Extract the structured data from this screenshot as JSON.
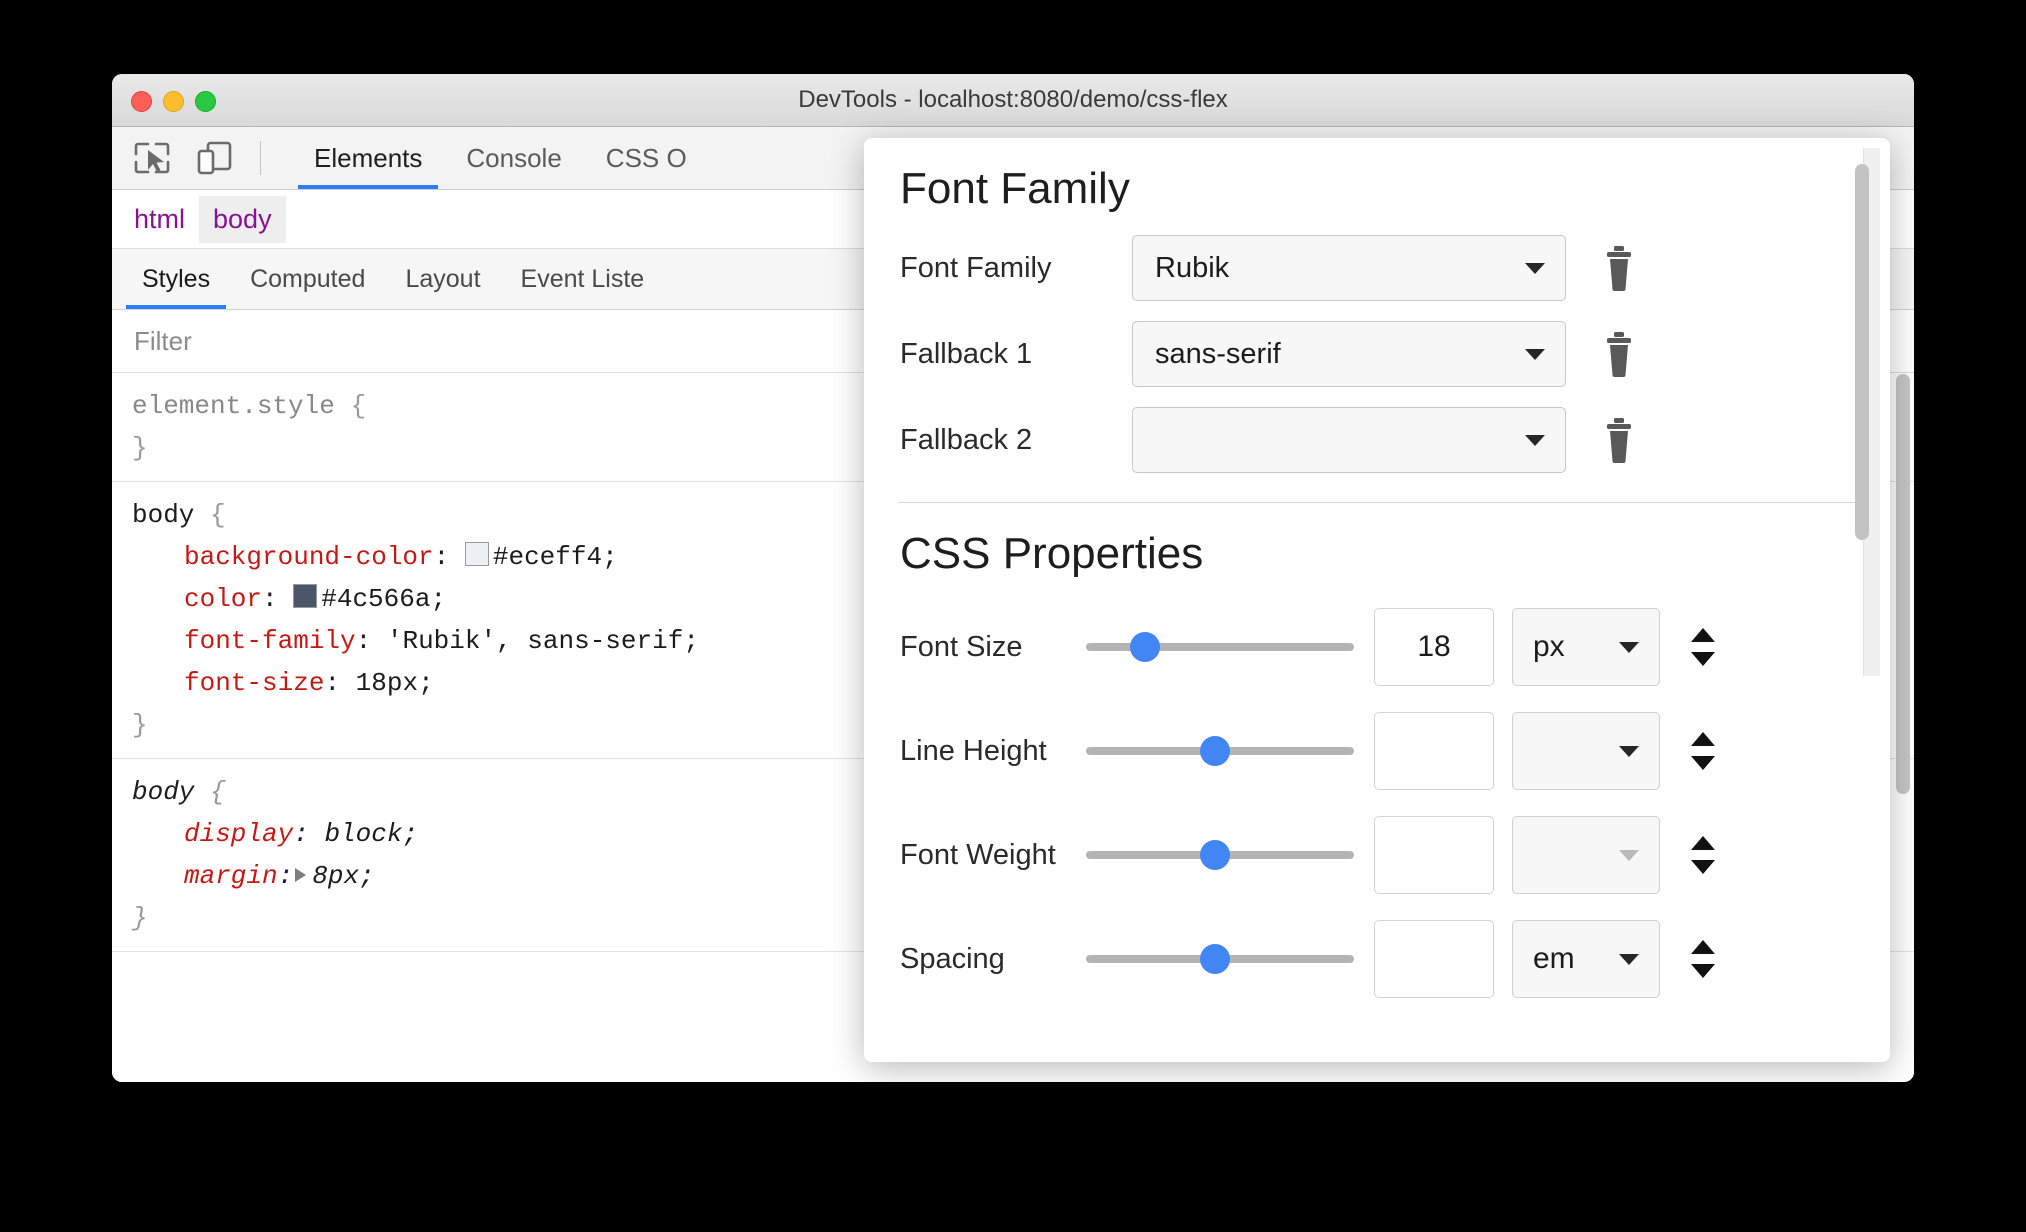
{
  "window": {
    "title": "DevTools - localhost:8080/demo/css-flex",
    "traffic_lights": [
      "close",
      "minimize",
      "maximize"
    ]
  },
  "toolbar": {
    "icons": [
      {
        "name": "inspect-element-icon",
        "label": "Inspect element"
      },
      {
        "name": "device-toolbar-icon",
        "label": "Toggle device toolbar"
      }
    ],
    "tabs": [
      {
        "label": "Elements",
        "active": true
      },
      {
        "label": "Console",
        "active": false
      },
      {
        "label": "CSS O",
        "active": false
      }
    ],
    "right_icons": [
      "record-button",
      "settings-icon",
      "more-options-icon"
    ]
  },
  "breadcrumb": {
    "items": [
      {
        "label": "html",
        "selected": false
      },
      {
        "label": "body",
        "selected": true
      }
    ]
  },
  "sidebar": {
    "tabs": [
      {
        "label": "Styles",
        "active": true
      },
      {
        "label": "Computed",
        "active": false
      },
      {
        "label": "Layout",
        "active": false
      },
      {
        "label": "Event Liste",
        "active": false
      }
    ]
  },
  "filter": {
    "placeholder": "Filter",
    "value": ""
  },
  "rules": [
    {
      "selector": "element.style",
      "origin": "inline",
      "declarations": []
    },
    {
      "selector": "body",
      "origin": "author",
      "declarations": [
        {
          "property": "background-color",
          "value": "#eceff4",
          "swatch": "#eceff4",
          "has_swatch": true,
          "has_expander": false
        },
        {
          "property": "color",
          "value": "#4c566a",
          "swatch": "#4c566a",
          "has_swatch": true,
          "has_expander": false
        },
        {
          "property": "font-family",
          "value": "'Rubik', sans-serif",
          "has_swatch": false,
          "has_expander": false
        },
        {
          "property": "font-size",
          "value": "18px",
          "has_swatch": false,
          "has_expander": false
        }
      ]
    },
    {
      "selector": "body",
      "origin": "user-agent",
      "declarations": [
        {
          "property": "display",
          "value": "block",
          "has_swatch": false,
          "has_expander": false
        },
        {
          "property": "margin",
          "value": "8px",
          "has_swatch": false,
          "has_expander": true
        }
      ]
    }
  ],
  "font_panel": {
    "font_family_section": {
      "heading": "Font Family",
      "rows": [
        {
          "label": "Font Family",
          "value": "Rubik",
          "delete_icon": "trash-icon"
        },
        {
          "label": "Fallback 1",
          "value": "sans-serif",
          "delete_icon": "trash-icon"
        },
        {
          "label": "Fallback 2",
          "value": "",
          "delete_icon": "trash-icon"
        }
      ]
    },
    "css_properties_section": {
      "heading": "CSS Properties",
      "rows": [
        {
          "label": "Font Size",
          "slider_pct": 22,
          "number": "18",
          "unit": "px",
          "unit_enabled": true
        },
        {
          "label": "Line Height",
          "slider_pct": 48,
          "number": "",
          "unit": "",
          "unit_enabled": true
        },
        {
          "label": "Font Weight",
          "slider_pct": 48,
          "number": "",
          "unit": "",
          "unit_enabled": false
        },
        {
          "label": "Spacing",
          "slider_pct": 48,
          "number": "",
          "unit": "em",
          "unit_enabled": true
        }
      ]
    }
  },
  "colors": {
    "accent": "#2d7ff9",
    "slider_thumb": "#4285f4",
    "property_name": "#c41a16",
    "breadcrumb_text": "#881391",
    "background_color_value": "#eceff4",
    "text_color_value": "#4c566a"
  }
}
